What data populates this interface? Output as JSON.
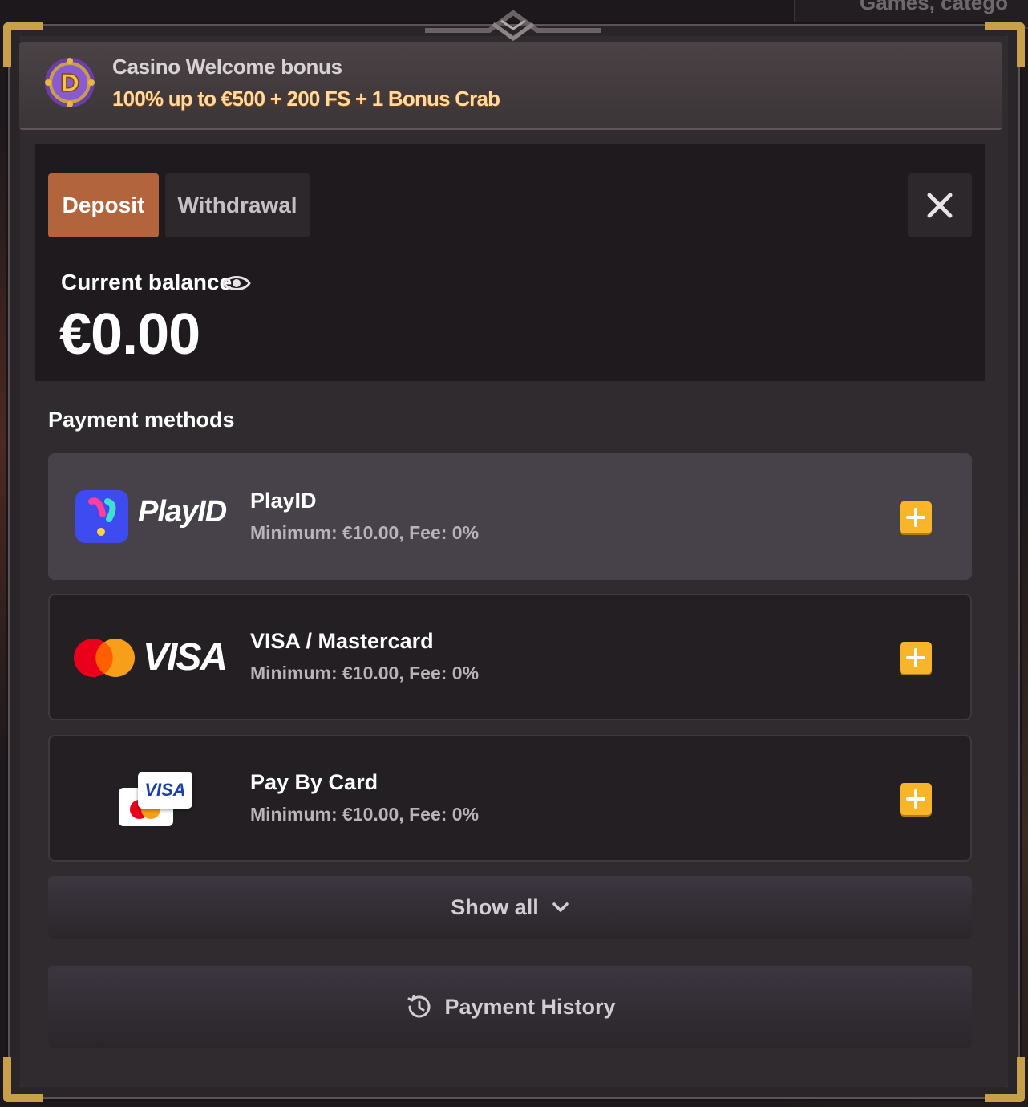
{
  "background": {
    "search_placeholder": "Games, catego"
  },
  "banner": {
    "title": "Casino Welcome bonus",
    "offer": "100% up to €500 + 200 FS + 1 Bonus Crab",
    "icon": "bonus-coin-icon"
  },
  "tabs": [
    {
      "label": "Deposit",
      "active": true
    },
    {
      "label": "Withdrawal",
      "active": false
    }
  ],
  "balance": {
    "label": "Current balance",
    "value": "€0.00"
  },
  "payment_methods": {
    "title": "Payment methods",
    "items": [
      {
        "name": "PlayID",
        "info": "Minimum: €10.00, Fee: 0%",
        "logo_text": "PlayID",
        "selected": true
      },
      {
        "name": "VISA / Mastercard",
        "info": "Minimum: €10.00, Fee: 0%",
        "logo_text": "VISA",
        "selected": false
      },
      {
        "name": "Pay By Card",
        "info": "Minimum: €10.00, Fee: 0%",
        "logo_text": "VISA",
        "selected": false
      }
    ]
  },
  "show_all_label": "Show all",
  "payment_history_label": "Payment History",
  "colors": {
    "accent": "#b2643c",
    "plus": "#f8b52a",
    "gold": "#c9a04a",
    "offer_text": "#ffd9a0"
  }
}
